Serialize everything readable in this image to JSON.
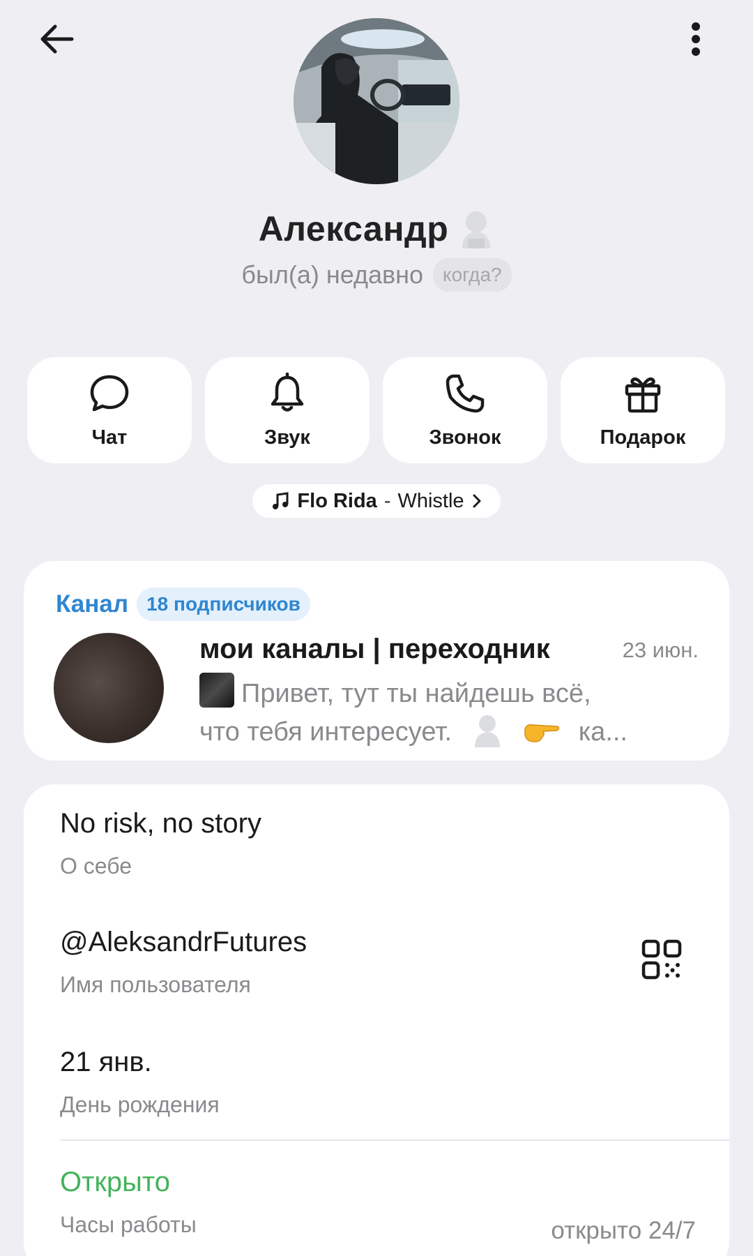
{
  "profile": {
    "name": "Александр",
    "status": "был(а) недавно",
    "when_label": "когда?"
  },
  "actions": [
    {
      "label": "Чат",
      "icon": "chat-icon"
    },
    {
      "label": "Звук",
      "icon": "bell-icon"
    },
    {
      "label": "Звонок",
      "icon": "phone-icon"
    },
    {
      "label": "Подарок",
      "icon": "gift-icon"
    }
  ],
  "music": {
    "artist": "Flo Rida",
    "separator": "-",
    "track": "Whistle"
  },
  "channel": {
    "label": "Канал",
    "subscribers": "18 подписчиков",
    "title": "мои каналы | переходник",
    "date": "23 июн.",
    "preview_line1": "Привет, тут ты найдешь всё,",
    "preview_line2_a": "что тебя интересует.",
    "preview_line2_b": "ка..."
  },
  "info": {
    "bio_value": "No risk, no story",
    "bio_label": "О себе",
    "username_value": "@AleksandrFutures",
    "username_label": "Имя пользователя",
    "birthday_value": "21 янв.",
    "birthday_label": "День рождения",
    "hours_value": "Открыто",
    "hours_label": "Часы работы",
    "hours_detail": "открыто 24/7"
  },
  "colors": {
    "accent_blue": "#2f86d0",
    "open_green": "#44b35a",
    "background": "#efeff3"
  }
}
